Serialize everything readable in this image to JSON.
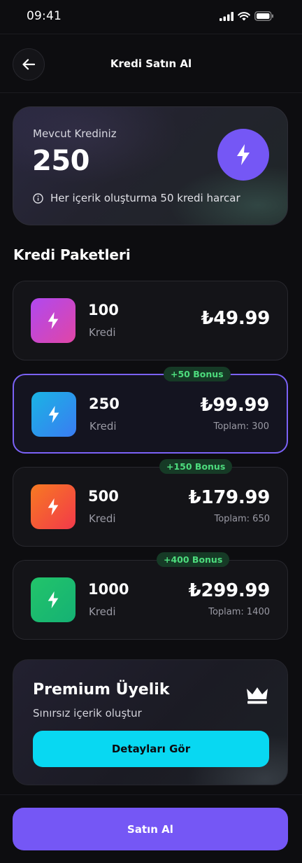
{
  "status_bar": {
    "time": "09:41"
  },
  "header": {
    "title": "Kredi Satın Al"
  },
  "credit": {
    "label": "Mevcut Krediniz",
    "value": "250",
    "info": "Her içerik oluşturma 50 kredi harcar"
  },
  "packages": {
    "title": "Kredi Paketleri",
    "items": [
      {
        "amount": "100",
        "unit": "Kredi",
        "price": "₺49.99",
        "bonus": "",
        "total": "",
        "selected": false,
        "color": "#c24be0"
      },
      {
        "amount": "250",
        "unit": "Kredi",
        "price": "₺99.99",
        "bonus": "+50 Bonus",
        "total": "Toplam: 300",
        "selected": true,
        "color": "#1e9ee8"
      },
      {
        "amount": "500",
        "unit": "Kredi",
        "price": "₺179.99",
        "bonus": "+150 Bonus",
        "total": "Toplam: 650",
        "selected": false,
        "color": "#f5552e"
      },
      {
        "amount": "1000",
        "unit": "Kredi",
        "price": "₺299.99",
        "bonus": "+400 Bonus",
        "total": "Toplam: 1400",
        "selected": false,
        "color": "#1dbe67"
      }
    ]
  },
  "premium": {
    "title": "Premium Üyelik",
    "subtitle": "Sınırsız içerik oluştur",
    "button_label": "Detayları Gör"
  },
  "buy_button": {
    "label": "Satın Al"
  },
  "colors": {
    "accent": "#7557f5",
    "bonus_text": "#4ddc7d",
    "premium_button": "#08d8f2"
  },
  "icons": {
    "back": "arrow-left-icon",
    "credit": "lightning-icon",
    "info": "info-icon",
    "premium": "crown-icon"
  }
}
